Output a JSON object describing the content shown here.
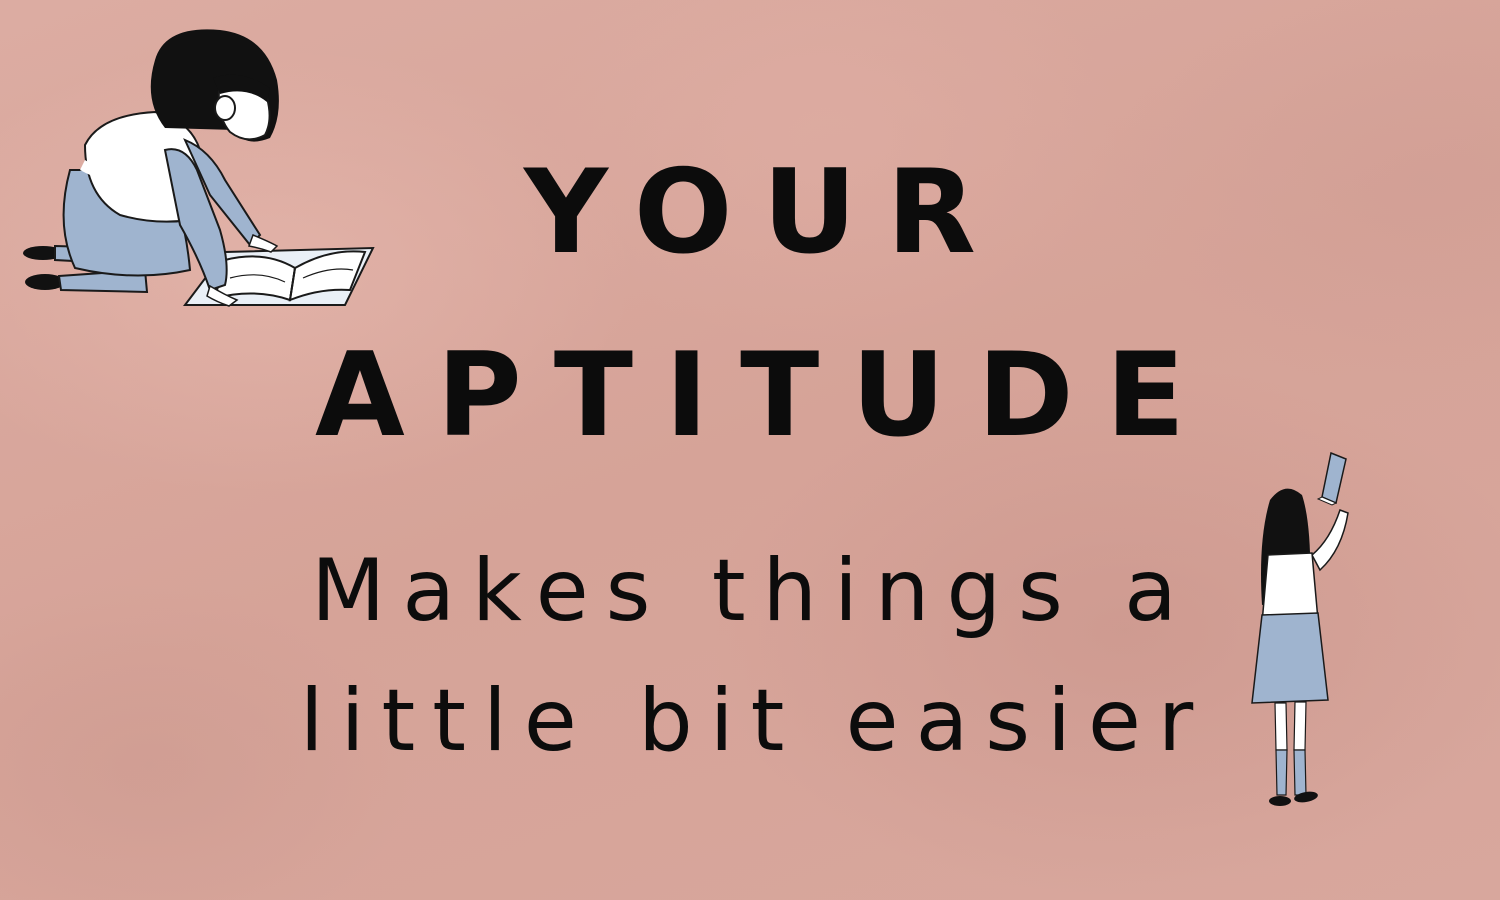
{
  "headline": {
    "line1": "YOUR",
    "line2": "APTITUDE"
  },
  "subline": {
    "line1": "Makes things a",
    "line2": "little bit easier"
  },
  "illustrations": {
    "left": "girl-reading-book-icon",
    "right": "girl-holding-book-icon"
  },
  "colors": {
    "background": "#d9a89e",
    "text": "#0c0c0c",
    "accent_blue": "#9fb4cf"
  }
}
